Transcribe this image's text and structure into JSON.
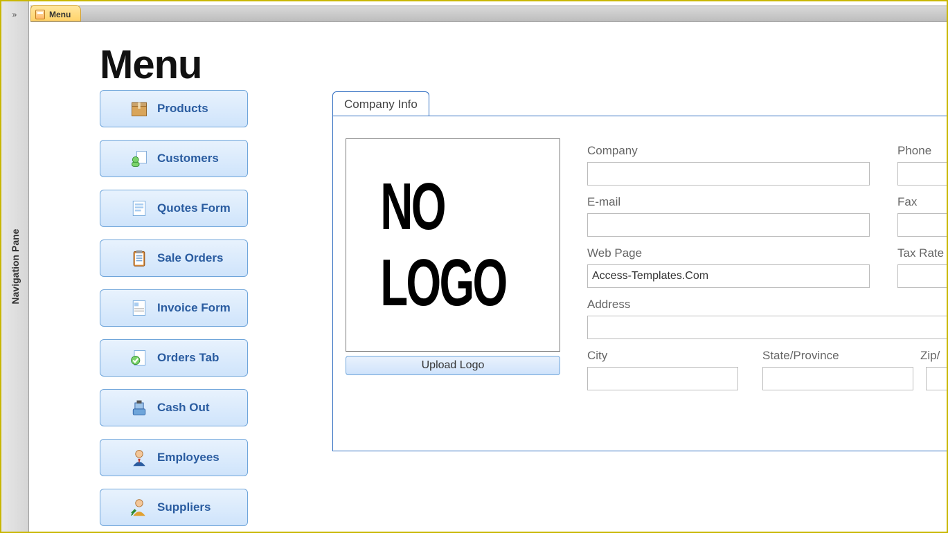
{
  "tab": {
    "title": "Menu"
  },
  "nav_pane_label": "Navigation Pane",
  "page_title": "Menu",
  "menu": {
    "items": [
      {
        "label": "Products"
      },
      {
        "label": "Customers"
      },
      {
        "label": "Quotes Form"
      },
      {
        "label": "Sale Orders"
      },
      {
        "label": "Invoice Form"
      },
      {
        "label": "Orders Tab"
      },
      {
        "label": "Cash Out"
      },
      {
        "label": "Employees"
      },
      {
        "label": "Suppliers"
      }
    ]
  },
  "company_info": {
    "tab_label": "Company Info",
    "logo_placeholder": "NO LOGO",
    "upload_label": "Upload Logo",
    "fields": {
      "company": {
        "label": "Company",
        "value": ""
      },
      "email": {
        "label": "E-mail",
        "value": ""
      },
      "web": {
        "label": "Web Page",
        "value": "Access-Templates.Com"
      },
      "address": {
        "label": "Address",
        "value": ""
      },
      "city": {
        "label": "City",
        "value": ""
      },
      "state": {
        "label": "State/Province",
        "value": ""
      },
      "phone": {
        "label": "Phone",
        "value": ""
      },
      "fax": {
        "label": "Fax",
        "value": ""
      },
      "tax": {
        "label": "Tax Rate",
        "value": ""
      },
      "zip": {
        "label": "Zip/",
        "value": ""
      }
    }
  }
}
